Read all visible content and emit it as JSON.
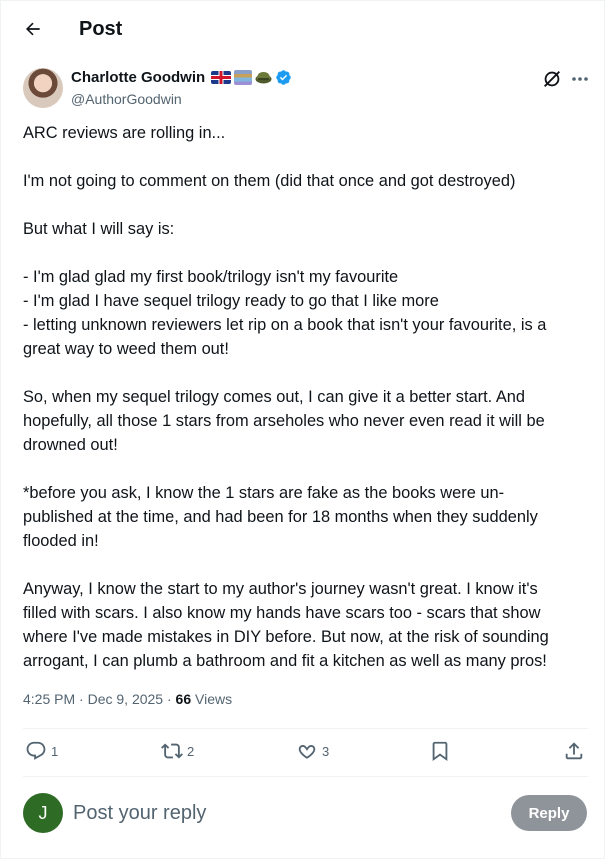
{
  "header": {
    "title": "Post"
  },
  "author": {
    "name": "Charlotte Goodwin",
    "handle": "@AuthorGoodwin",
    "badge_icons": [
      "uk-flag-icon",
      "books-icon",
      "helmet-icon",
      "verified-badge-icon"
    ]
  },
  "post": {
    "paragraphs": [
      [
        "ARC reviews are rolling in..."
      ],
      [
        "I'm not going to comment on them (did that once and got destroyed)"
      ],
      [
        "But what I will say is:"
      ],
      [
        "- I'm glad glad my first book/trilogy isn't my favourite",
        "- I'm glad I have sequel trilogy ready to go that I like more",
        "- letting unknown reviewers let rip on a book that isn't your favourite, is a",
        "great way to weed them out!"
      ],
      [
        "So, when my sequel trilogy comes out, I can give it a better start. And",
        "hopefully, all those 1 stars from arseholes who never even read it will be",
        "drowned out!"
      ],
      [
        "*before you ask, I know the 1 stars are fake as the books were un-",
        "published at the time, and had been for 18 months when they suddenly",
        "flooded in!"
      ],
      [
        "Anyway, I know the start to my author's journey wasn't great. I know it's",
        "filled with scars. I also know my hands have scars too - scars that show",
        "where I've made mistakes in DIY before. But now, at the risk of sounding",
        "arrogant, I can plumb a bathroom and fit a kitchen as well as many pros!"
      ]
    ],
    "time": "4:25 PM",
    "date": "Dec 9, 2025",
    "views_count": "66",
    "views_label": "Views"
  },
  "actions": {
    "replies": "1",
    "reposts": "2",
    "likes": "3"
  },
  "reply": {
    "avatar_letter": "J",
    "placeholder": "Post your reply",
    "button_label": "Reply"
  },
  "colors": {
    "text": "#0f1419",
    "secondary": "#536471",
    "verified": "#1d9bf0",
    "reply_avatar": "#2e6b24",
    "reply_button": "#8e9499",
    "divider": "#eff3f4"
  }
}
